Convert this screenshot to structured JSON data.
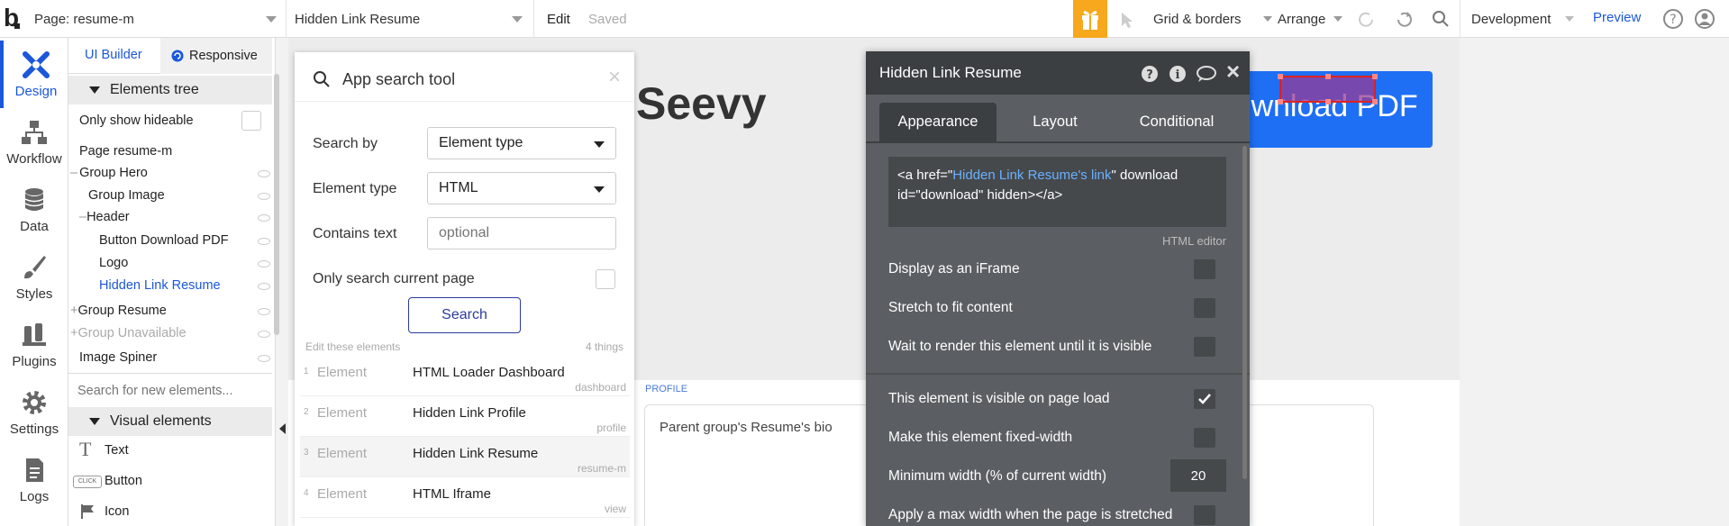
{
  "topbar": {
    "logo": "b",
    "page_selector": "Page: resume-m",
    "element_selector": "Hidden Link Resume",
    "edit": "Edit",
    "saved": "Saved",
    "grid_borders": "Grid & borders",
    "arrange": "Arrange",
    "development": "Development",
    "preview": "Preview"
  },
  "nav": [
    {
      "label": "Design",
      "icon": "design-icon"
    },
    {
      "label": "Workflow",
      "icon": "workflow-icon"
    },
    {
      "label": "Data",
      "icon": "database-icon"
    },
    {
      "label": "Styles",
      "icon": "brush-icon"
    },
    {
      "label": "Plugins",
      "icon": "plug-icon"
    },
    {
      "label": "Settings",
      "icon": "gear-icon"
    },
    {
      "label": "Logs",
      "icon": "document-icon"
    }
  ],
  "elements_panel": {
    "tab_ui_builder": "UI Builder",
    "tab_responsive": "Responsive",
    "tree_title": "Elements tree",
    "only_hideable": "Only show hideable",
    "tree": [
      {
        "label": "Page resume-m"
      },
      {
        "label": "Group Hero"
      },
      {
        "label": "Group Image"
      },
      {
        "label": "Header"
      },
      {
        "label": "Button Download PDF"
      },
      {
        "label": "Logo"
      },
      {
        "label": "Hidden Link Resume"
      },
      {
        "label": "Group Resume"
      },
      {
        "label": "Group Unavailable"
      },
      {
        "label": "Image Spiner"
      }
    ],
    "search_placeholder": "Search for new elements...",
    "visual_title": "Visual elements",
    "visual": [
      {
        "label": "Text",
        "icon": "text-icon"
      },
      {
        "label": "Button",
        "icon": "button-icon",
        "icon_text": "CLICK"
      },
      {
        "label": "Icon",
        "icon": "flag-icon"
      }
    ]
  },
  "canvas": {
    "brand_text": "Seevy",
    "download_button": "Download PDF",
    "profile_label": "PROFILE",
    "bio_text": "Parent group's Resume's bio"
  },
  "search_tool": {
    "title": "App search tool",
    "search_by_label": "Search by",
    "search_by_value": "Element type",
    "element_type_label": "Element type",
    "element_type_value": "HTML",
    "contains_text_label": "Contains text",
    "contains_text_placeholder": "optional",
    "only_current_page": "Only search current page",
    "search_button": "Search",
    "edit_these": "Edit these elements",
    "count": "4 things",
    "results": [
      {
        "num": "1",
        "type": "Element",
        "name": "HTML Loader Dashboard",
        "page": "dashboard"
      },
      {
        "num": "2",
        "type": "Element",
        "name": "Hidden Link Profile",
        "page": "profile"
      },
      {
        "num": "3",
        "type": "Element",
        "name": "Hidden Link Resume",
        "page": "resume-m"
      },
      {
        "num": "4",
        "type": "Element",
        "name": "HTML Iframe",
        "page": "view"
      }
    ]
  },
  "property_editor": {
    "title": "Hidden Link Resume",
    "tabs": [
      "Appearance",
      "Layout",
      "Conditional"
    ],
    "html_part1": "<a href=\"",
    "html_dynamic": "Hidden Link Resume's link",
    "html_part2": "\" download",
    "html_line2": "id=\"download\" hidden></a>",
    "html_editor_label": "HTML editor",
    "options": [
      {
        "label": "Display as an iFrame",
        "checked": false
      },
      {
        "label": "Stretch to fit content",
        "checked": false
      },
      {
        "label": "Wait to render this element until it is visible",
        "checked": false
      },
      {
        "label": "This element is visible on page load",
        "checked": true
      },
      {
        "label": "Make this element fixed-width",
        "checked": false
      },
      {
        "label": "Minimum width (% of current width)",
        "value": "20"
      },
      {
        "label": "Apply a max width when the page is stretched",
        "checked": false
      }
    ]
  },
  "colors": {
    "accent": "#1b57d9",
    "gift": "#f7a81c",
    "download_button_bg": "#1f6ff5",
    "panel_bg": "#5b5f63",
    "panel_head": "#3b3f42"
  }
}
